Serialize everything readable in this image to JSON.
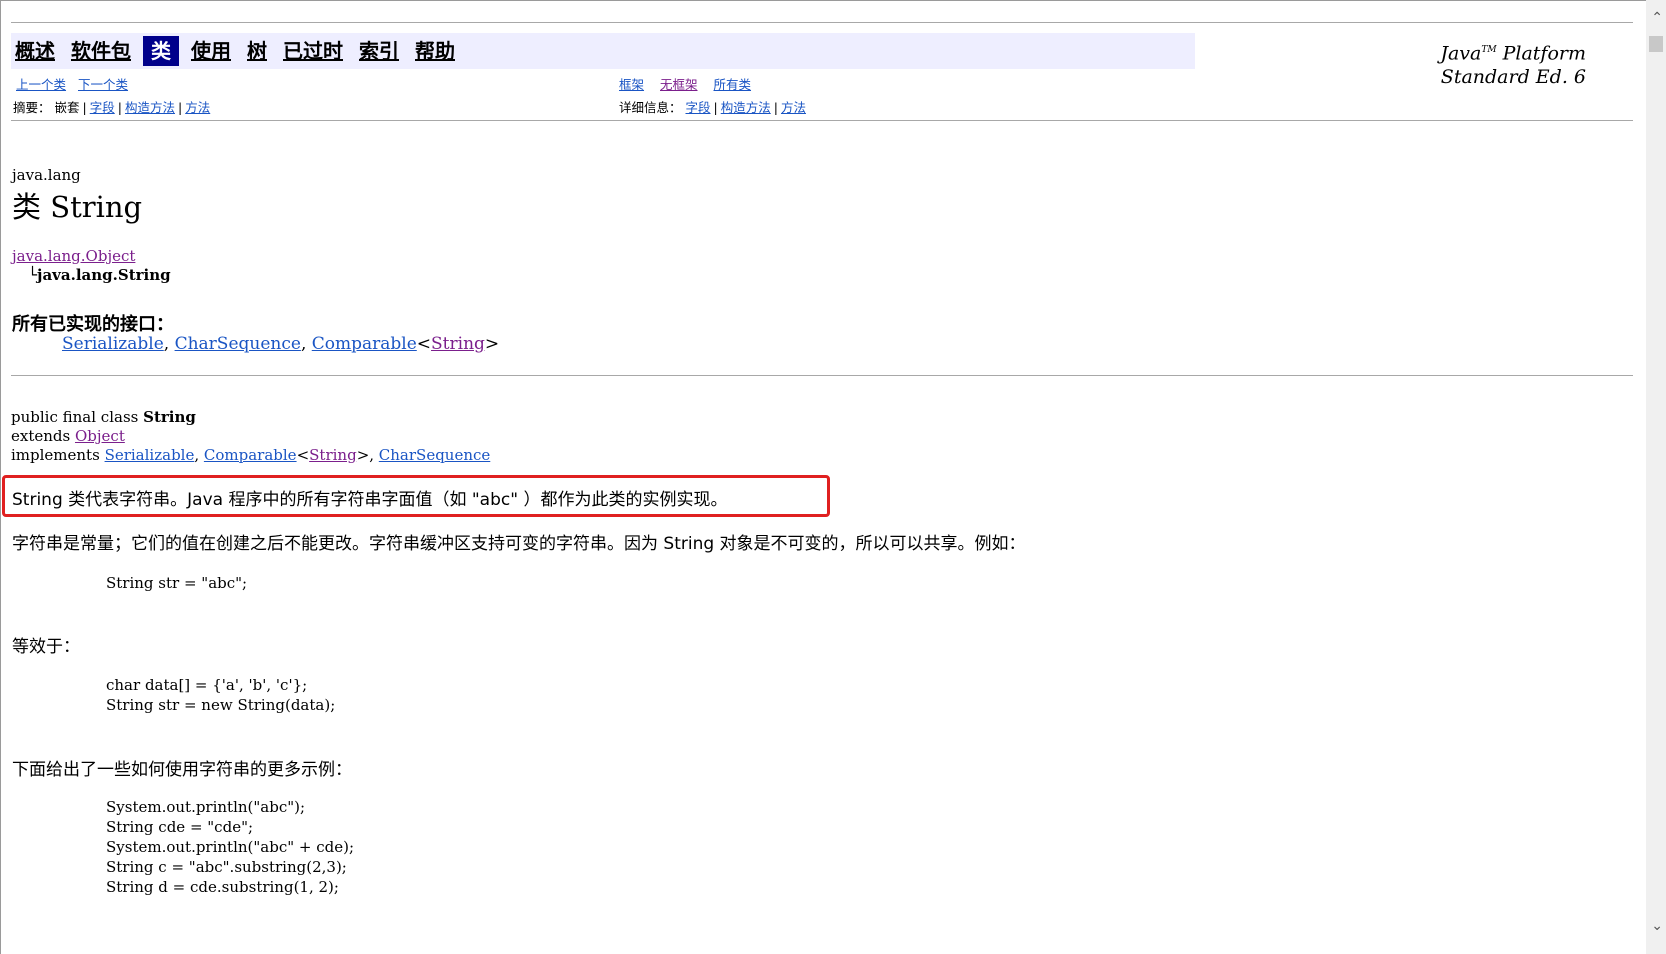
{
  "nav": {
    "items": [
      "概述",
      "软件包",
      "类",
      "使用",
      "树",
      "已过时",
      "索引",
      "帮助"
    ],
    "active_index": 2
  },
  "platform": {
    "line1": "Java",
    "tm": "TM",
    "line1_rest": " Platform",
    "line2": "Standard Ed. 6"
  },
  "subnav": {
    "prev_class": "上一个类",
    "next_class": "下一个类",
    "frames": "框架",
    "no_frames": "无框架",
    "all_classes": "所有类",
    "summary_label": "摘要：",
    "summary_nested": "嵌套",
    "summary_field": "字段",
    "summary_constructor": "构造方法",
    "summary_method": "方法",
    "detail_label": "详细信息：",
    "detail_field": "字段",
    "detail_constructor": "构造方法",
    "detail_method": "方法"
  },
  "header": {
    "package": "java.lang",
    "class_title": "类 String",
    "parent": "java.lang.Object",
    "child_prefix": "└",
    "child": "java.lang.String"
  },
  "interfaces": {
    "title": "所有已实现的接口：",
    "serializable": "Serializable",
    "charsequence": "CharSequence",
    "comparable": "Comparable",
    "string": "String"
  },
  "declaration": {
    "line1_prefix": "public final class ",
    "line1_name": "String",
    "extends_kw": "extends ",
    "extends": "Object",
    "implements_kw": "implements ",
    "impl1": "Serializable",
    "impl2": "Comparable",
    "impl2_arg": "String",
    "impl3": "CharSequence"
  },
  "description": {
    "highlight": "String 类代表字符串。Java 程序中的所有字符串字面值（如 \"abc\" ）都作为此类的实例实现。",
    "para1": "字符串是常量；它们的值在创建之后不能更改。字符串缓冲区支持可变的字符串。因为 String 对象是不可变的，所以可以共享。例如：",
    "code1": "String str = \"abc\";",
    "para2": "等效于：",
    "code2": "char data[] = {'a', 'b', 'c'};\nString str = new String(data);",
    "para3": "下面给出了一些如何使用字符串的更多示例：",
    "code3": "System.out.println(\"abc\");\nString cde = \"cde\";\nSystem.out.println(\"abc\" + cde);\nString c = \"abc\".substring(2,3);\nString d = cde.substring(1, 2);"
  },
  "colors": {
    "accent": "#e02020",
    "nav_bg": "#eeeeff",
    "active_bg": "#00008b",
    "link": "#1a55c4",
    "visited": "#7b1f8c"
  }
}
